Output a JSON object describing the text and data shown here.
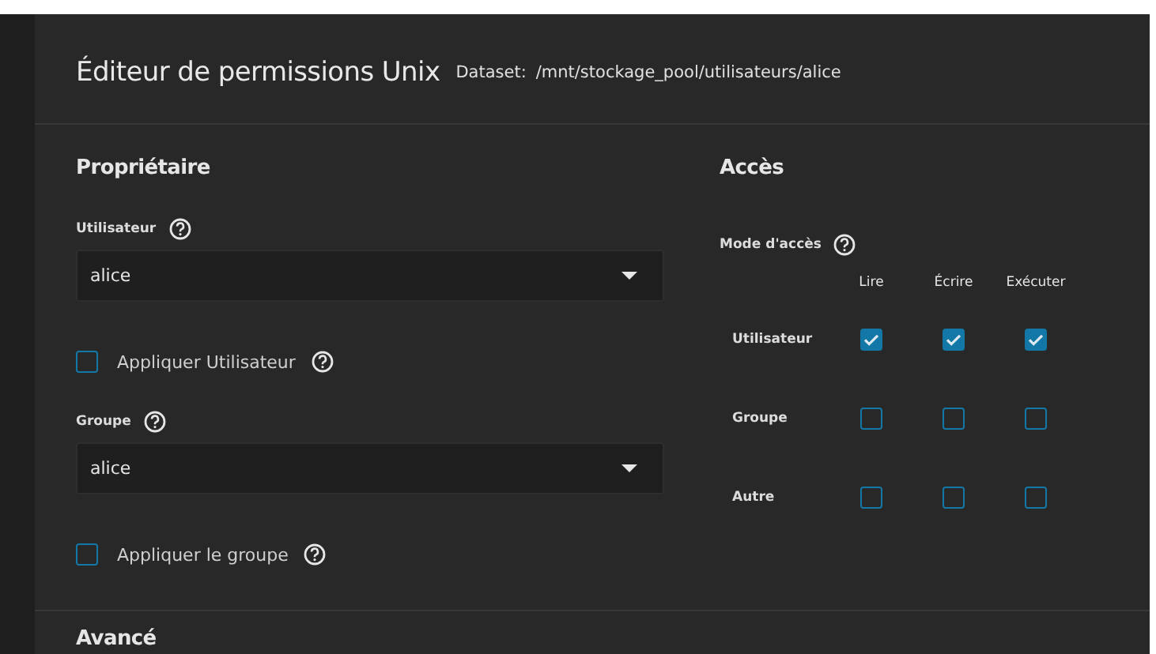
{
  "header": {
    "title": "Éditeur de permissions Unix",
    "dataset_label": "Dataset:",
    "dataset_path": "/mnt/stockage_pool/utilisateurs/alice"
  },
  "owner": {
    "title": "Propriétaire",
    "fields": [
      {
        "label": "Utilisateur",
        "value": "alice",
        "apply_label": "Appliquer Utilisateur",
        "apply_checked": false
      },
      {
        "label": "Groupe",
        "value": "alice",
        "apply_label": "Appliquer le groupe",
        "apply_checked": false
      }
    ]
  },
  "access": {
    "title": "Accès",
    "mode_label": "Mode d'accès",
    "columns": [
      "Lire",
      "Écrire",
      "Exécuter"
    ],
    "rows": [
      {
        "label": "Utilisateur",
        "checked": [
          true,
          true,
          true
        ]
      },
      {
        "label": "Groupe",
        "checked": [
          false,
          false,
          false
        ]
      },
      {
        "label": "Autre",
        "checked": [
          false,
          false,
          false
        ]
      }
    ]
  },
  "next_section": {
    "title": "Avancé"
  }
}
